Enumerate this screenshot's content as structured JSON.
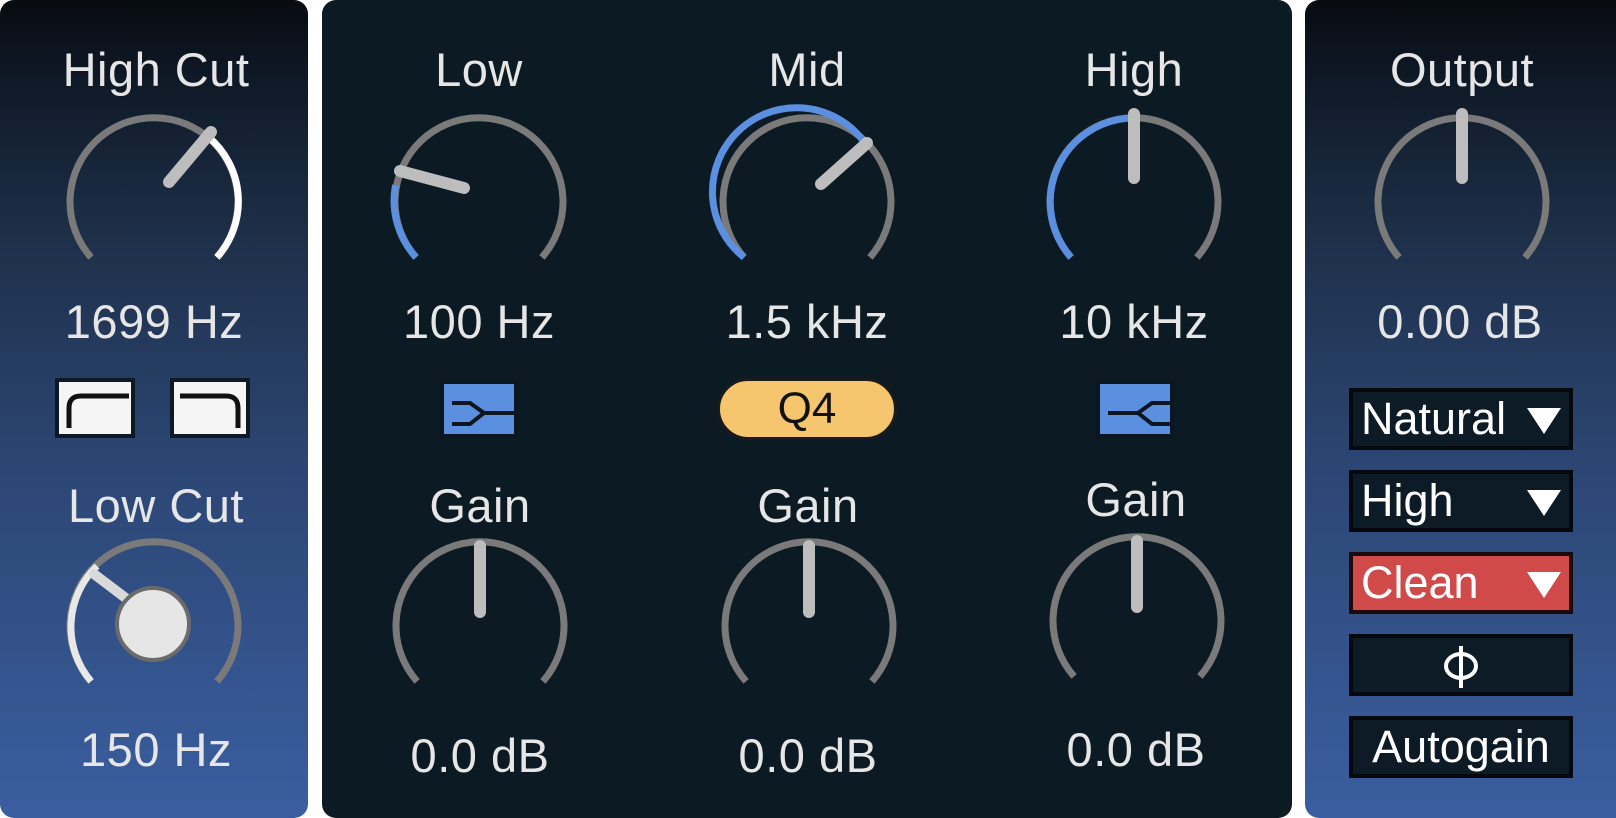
{
  "left": {
    "high_cut": {
      "label": "High Cut",
      "value": "1699 Hz"
    },
    "low_cut": {
      "label": "Low Cut",
      "value": "150 Hz"
    }
  },
  "bands": {
    "low": {
      "label": "Low",
      "freq": "100 Hz",
      "gain_label": "Gain",
      "gain_value": "0.0 dB"
    },
    "mid": {
      "label": "Mid",
      "freq": "1.5 kHz",
      "q_label": "Q4",
      "gain_label": "Gain",
      "gain_value": "0.0 dB"
    },
    "high": {
      "label": "High",
      "freq": "10 kHz",
      "gain_label": "Gain",
      "gain_value": "0.0 dB"
    }
  },
  "output": {
    "label": "Output",
    "value": "0.00 dB",
    "mode_dropdown": "Natural",
    "quality_dropdown": "High",
    "character_dropdown": "Clean",
    "autogain_label": "Autogain"
  },
  "colors": {
    "accent_blue": "#5b8fe0",
    "q_yellow": "#f5c66d",
    "clean_red": "#d04a4a",
    "knob_track": "#7a7a7a"
  }
}
